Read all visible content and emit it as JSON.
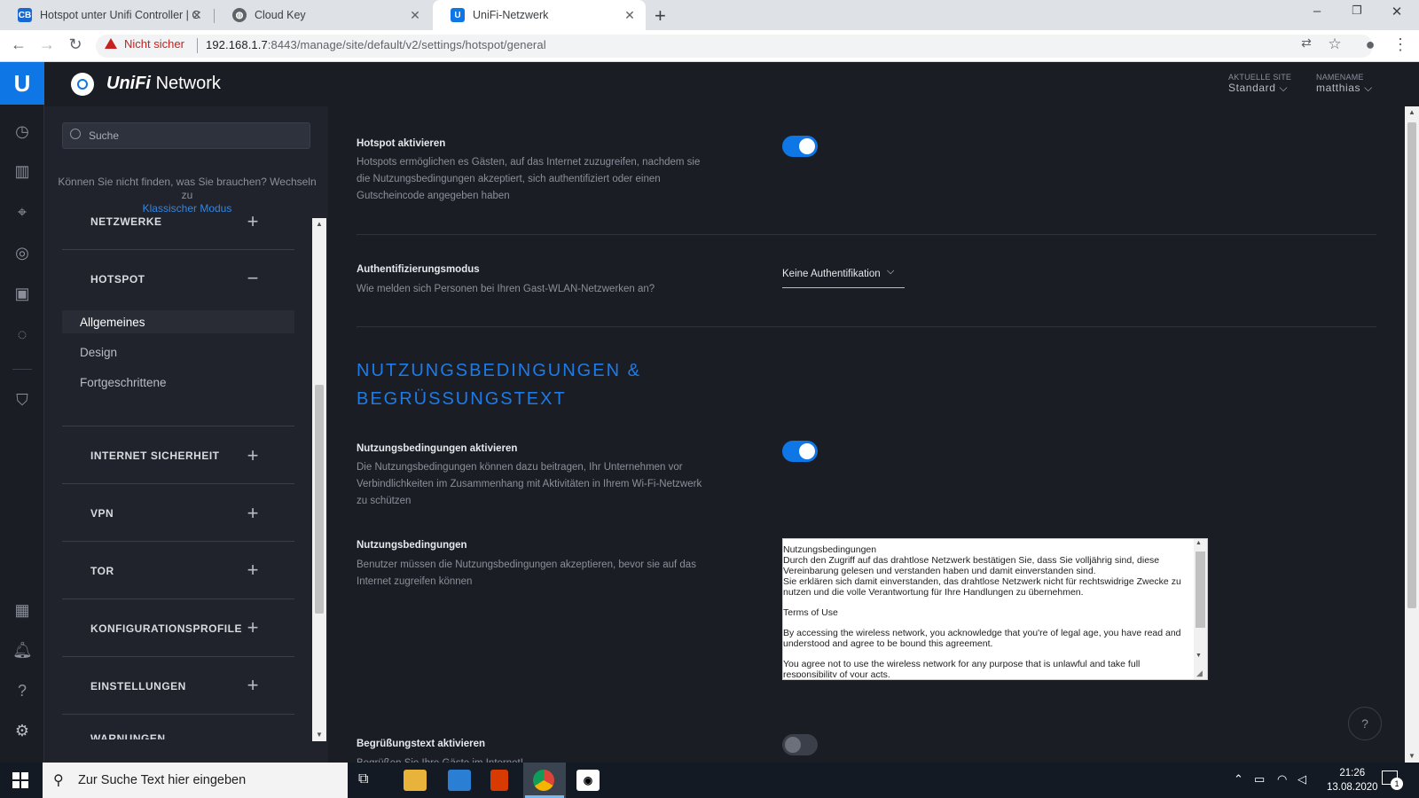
{
  "browser": {
    "tabs": [
      {
        "label": "Hotspot unter Unifi Controller | C",
        "icon": "cb-favicon"
      },
      {
        "label": "Cloud Key",
        "icon": "globe-favicon"
      },
      {
        "label": "UniFi-Netzwerk",
        "icon": "unifi-favicon"
      }
    ],
    "security_label": "Nicht sicher",
    "url_host": "192.168.1.7",
    "url_rest": ":8443/manage/site/default/v2/settings/hotspot/general"
  },
  "header": {
    "brand_unifi": "UniFi",
    "brand_network": "Network",
    "site_label": "AKTUELLE SITE",
    "site_value": "Standard",
    "user_label": "NAMENAME",
    "user_value": "matthias"
  },
  "sidebar": {
    "search_placeholder": "Suche",
    "hint": "Können Sie nicht finden, was Sie brauchen? Wechseln zu",
    "hint_link": "Klassischer Modus",
    "sections": [
      "NETZWERKE",
      "HOTSPOT",
      "INTERNET SICHERHEIT",
      "VPN",
      "TOR",
      "KONFIGURATIONSPROFILE",
      "EINSTELLUNGEN",
      "WARNUNGEN"
    ],
    "hotspot_items": [
      "Allgemeines",
      "Design",
      "Fortgeschrittene"
    ],
    "active_item": "Allgemeines"
  },
  "content": {
    "hotspot_title": "Hotspot aktivieren",
    "hotspot_desc": "Hotspots ermöglichen es Gästen, auf das Internet zuzugreifen, nachdem sie die Nutzungsbedingungen akzeptiert, sich authentifiziert oder einen Gutscheincode angegeben haben",
    "hotspot_enabled": true,
    "auth_title": "Authentifizierungsmodus",
    "auth_desc": "Wie melden sich Personen bei Ihren Gast-WLAN-Netzwerken an?",
    "auth_value": "Keine Authentifikation",
    "terms_heading_1": "NUTZUNGSBEDINGUNGEN &",
    "terms_heading_2": "BEGRÜSSUNGSTEXT",
    "terms_enable_title": "Nutzungsbedingungen aktivieren",
    "terms_enable_desc": "Die Nutzungsbedingungen können dazu beitragen, Ihr Unternehmen vor Verbindlichkeiten im Zusammenhang mit Aktivitäten in Ihrem Wi-Fi-Netzwerk zu schützen",
    "terms_enabled": true,
    "terms_title": "Nutzungsbedingungen",
    "terms_desc": "Benutzer müssen die Nutzungsbedingungen akzeptieren, bevor sie auf das Internet zugreifen können",
    "terms_text": [
      "Nutzungsbedingungen\nDurch den Zugriff auf das drahtlose Netzwerk bestätigen Sie, dass Sie volljährig sind, diese Vereinbarung gelesen und verstanden haben und damit einverstanden sind.\nSie erklären sich damit einverstanden, das drahtlose Netzwerk nicht für rechtswidrige Zwecke zu nutzen und die volle Verantwortung für Ihre Handlungen zu übernehmen.",
      "Terms of Use",
      "By accessing the wireless network, you acknowledge that you're of legal age, you have read and understood and agree to be bound this agreement.",
      "You agree not to use the wireless network for any purpose that is unlawful and take full responsibility of your acts."
    ],
    "welcome_title": "Begrüßungstext aktivieren",
    "welcome_desc": "Begrüßen Sie Ihre Gäste im Internet!",
    "welcome_enabled": false,
    "help_label": "?"
  },
  "taskbar": {
    "search_placeholder": "Zur Suche Text hier eingeben",
    "time": "21:26",
    "date": "13.08.2020",
    "notification_count": "1"
  },
  "colors": {
    "accent": "#0e76e5",
    "background": "#1b1d25",
    "sidebar": "#20232b"
  }
}
